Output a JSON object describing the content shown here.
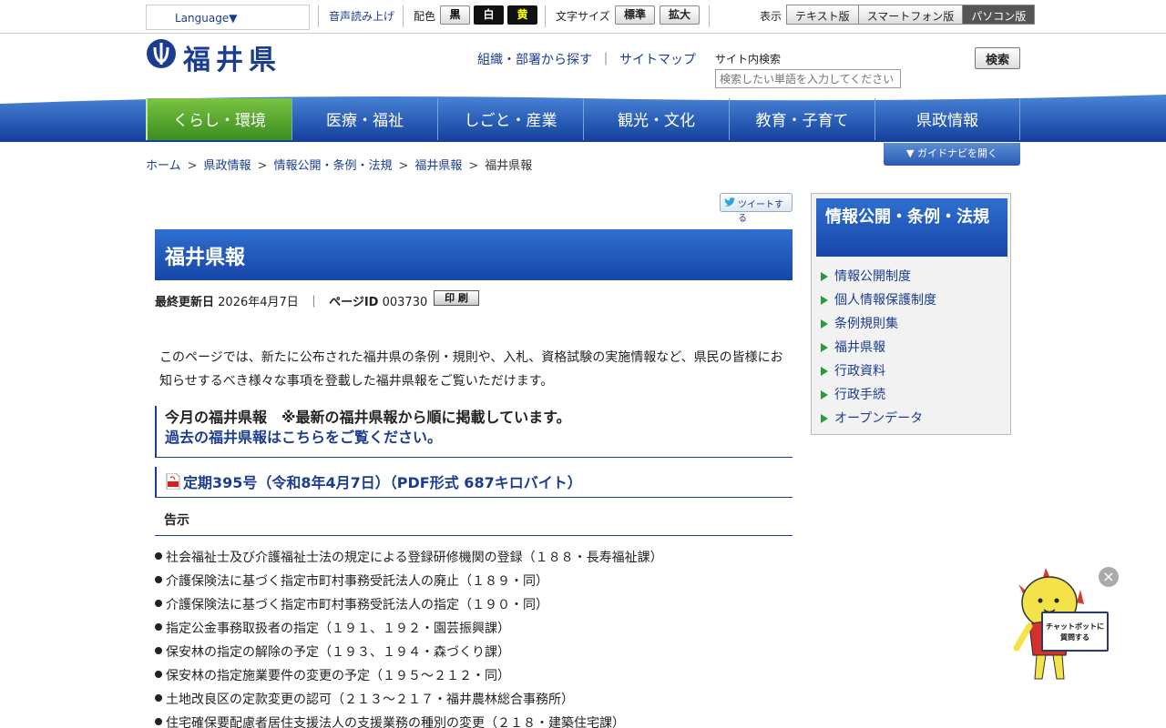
{
  "utility": {
    "language": "Language▼",
    "voice": "音声読み上げ",
    "color_label": "配色",
    "color_black": "黒",
    "color_white": "白",
    "color_yellow": "黄",
    "fontsize_label": "文字サイズ",
    "fontsize_normal": "標準",
    "fontsize_large": "拡大",
    "view_label": "表示",
    "view_text": "テキスト版",
    "view_smartphone": "スマートフォン版",
    "view_pc": "パソコン版"
  },
  "header": {
    "logo": "福井県",
    "link_org": "組織・部署から探す",
    "pipe": "｜",
    "link_sitemap": "サイトマップ",
    "search_label": "サイト内検索",
    "search_placeholder": "検索したい単語を入力してください",
    "search_button": "検索"
  },
  "nav": {
    "items": [
      "くらし・環境",
      "医療・福祉",
      "しごと・産業",
      "観光・文化",
      "教育・子育て",
      "県政情報"
    ],
    "guide": "▼ ガイドナビを開く"
  },
  "breadcrumb": [
    "ホーム",
    "県政情報",
    "情報公開・条例・法規",
    "福井県報",
    "福井県報"
  ],
  "breadcrumb_sep": ">",
  "tweet": "ツイートする",
  "main": {
    "title": "福井県報",
    "updated_label": "最終更新日",
    "updated_value": "2026年4月7日",
    "meta_sep": "｜",
    "page_id_label": "ページID",
    "page_id_value": "003730",
    "print": "印 刷",
    "intro": "このページでは、新たに公布された福井県の条例・規則や、入札、資格試験の実施情報など、県民の皆様にお知らせするべき様々な事項を登載した福井県報をご覧いただけます。",
    "month_heading": "今月の福井県報　※最新の福井県報から順に掲載しています。",
    "past_link": "過去の福井県報はこちらをご覧ください。",
    "pdf_link": "定期395号（令和8年4月7日）（PDF形式 687キロバイト）",
    "kokuji_heading": "告示",
    "kokuji_items": [
      "社会福祉士及び介護福祉士法の規定による登録研修機関の登録（１８８・長寿福祉課）",
      "介護保険法に基づく指定市町村事務受託法人の廃止（１８９・同）",
      "介護保険法に基づく指定市町村事務受託法人の指定（１９０・同）",
      "指定公金事務取扱者の指定（１９１、１９２・園芸振興課）",
      "保安林の指定の解除の予定（１９３、１９４・森づくり課）",
      "保安林の指定施業要件の変更の予定（１９５～２１２・同）",
      "土地改良区の定款変更の認可（２１３～２１７・福井農林総合事務所）",
      "住宅確保要配慮者居住支援法人の支援業務の種別の変更（２１８・建築住宅課）"
    ]
  },
  "side": {
    "heading": "情報公開・条例・法規",
    "items": [
      "情報公開制度",
      "個人情報保護制度",
      "条例規則集",
      "福井県報",
      "行政資料",
      "行政手続",
      "オープンデータ"
    ]
  },
  "chatbot": {
    "close": "×",
    "sign_line1": "チャットボットに",
    "sign_line2": "質問する"
  },
  "colors": {
    "brand_blue": "#1a3d8f",
    "nav_active": "#3a8d1f",
    "side_bullet": "#2a9a3a"
  }
}
